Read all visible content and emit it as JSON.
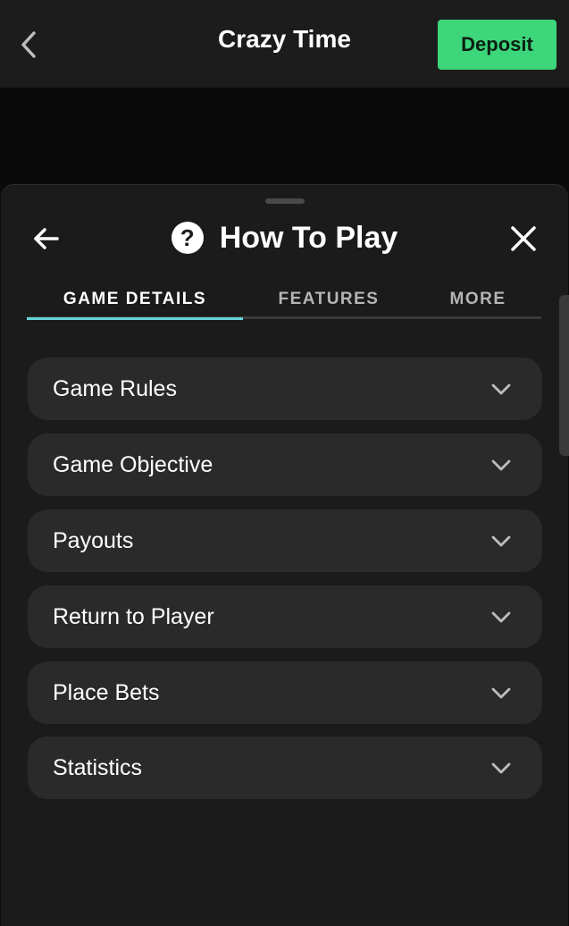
{
  "header": {
    "title": "Crazy Time",
    "deposit_label": "Deposit"
  },
  "sheet": {
    "title": "How To Play",
    "tabs": [
      {
        "label": "GAME DETAILS",
        "active": true
      },
      {
        "label": "FEATURES",
        "active": false
      },
      {
        "label": "MORE",
        "active": false
      }
    ],
    "items": [
      {
        "label": "Game Rules"
      },
      {
        "label": "Game Objective"
      },
      {
        "label": "Payouts"
      },
      {
        "label": "Return to Player"
      },
      {
        "label": "Place Bets"
      },
      {
        "label": "Statistics"
      }
    ]
  },
  "colors": {
    "accent": "#3dd67b",
    "tab_indicator": "#63d3d6",
    "background": "#0a0a0a",
    "sheet": "#1b1b1b",
    "row": "#2a2a2a"
  },
  "icons": [
    "chevron-left-icon",
    "arrow-left-icon",
    "help-icon",
    "close-icon",
    "chevron-down-icon"
  ]
}
